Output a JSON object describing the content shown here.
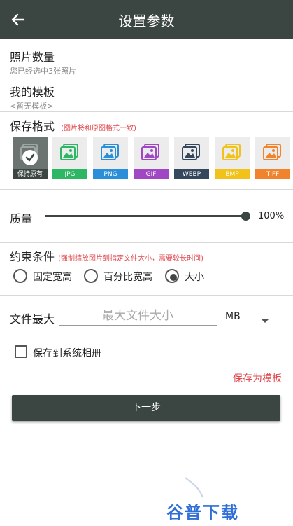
{
  "header": {
    "title": "设置参数"
  },
  "photo_count": {
    "label": "照片数量",
    "sub": "您已经选中3张照片"
  },
  "template": {
    "label": "我的模板",
    "sub": "<暂无模板>"
  },
  "save_format": {
    "label": "保存格式",
    "hint": "(图片将和原图格式一致)",
    "options": [
      {
        "tag": "保持原有",
        "color": "#3b4541",
        "selected": true
      },
      {
        "tag": "JPG",
        "color": "#2db765",
        "selected": false
      },
      {
        "tag": "PNG",
        "color": "#2a8fd8",
        "selected": false
      },
      {
        "tag": "GIF",
        "color": "#a048c4",
        "selected": false
      },
      {
        "tag": "WEBP",
        "color": "#34475c",
        "selected": false
      },
      {
        "tag": "BMP",
        "color": "#f2c21a",
        "selected": false
      },
      {
        "tag": "TIFF",
        "color": "#f0832c",
        "selected": false
      }
    ]
  },
  "quality": {
    "label": "质量",
    "value_text": "100%",
    "value": 1.0
  },
  "constraint": {
    "label": "约束条件",
    "hint": "(强制缩放图片到指定文件大小，需要较长时间)",
    "options": [
      "固定宽高",
      "百分比宽高",
      "大小"
    ],
    "selected_index": 2
  },
  "file_max": {
    "label": "文件最大",
    "placeholder": "最大文件大小",
    "unit": "MB"
  },
  "save_album": {
    "label": "保存到系统相册",
    "checked": false
  },
  "save_template": {
    "label": "保存为模板"
  },
  "next": {
    "label": "下一步"
  },
  "watermark": {
    "text": "谷普下载"
  },
  "colors": {
    "primary": "#3b4541",
    "accent": "#e0474c"
  }
}
